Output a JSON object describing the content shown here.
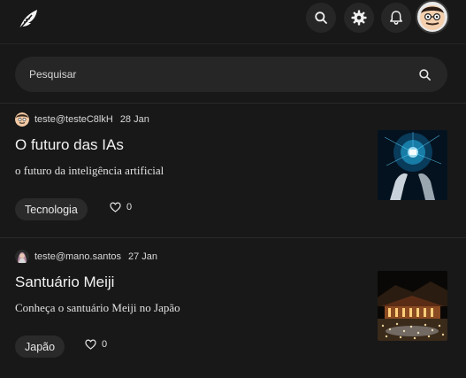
{
  "header": {
    "logo_icon": "feather-icon",
    "icons": [
      "search-icon",
      "settings-gear-icon",
      "bell-icon"
    ],
    "avatar_icon": "user-avatar"
  },
  "search": {
    "placeholder": "Pesquisar",
    "icon": "search-icon"
  },
  "posts": [
    {
      "author": "teste@testeC8lkH",
      "date": "28 Jan",
      "title": "O futuro das IAs",
      "description": "o futuro da inteligência artificial",
      "tag": "Tecnologia",
      "likes": "0",
      "thumbnail_icon": "ai-robot-brain-image"
    },
    {
      "author": "teste@mano.santos",
      "date": "27 Jan",
      "title": "Santuário Meiji",
      "description": "Conheça o santuário Meiji no Japão",
      "tag": "Japão",
      "likes": "0",
      "thumbnail_icon": "meiji-shrine-night-image"
    }
  ],
  "colors": {
    "background": "#181818",
    "surface": "#262626",
    "text": "#ececec",
    "divider": "#2a2a2a"
  }
}
